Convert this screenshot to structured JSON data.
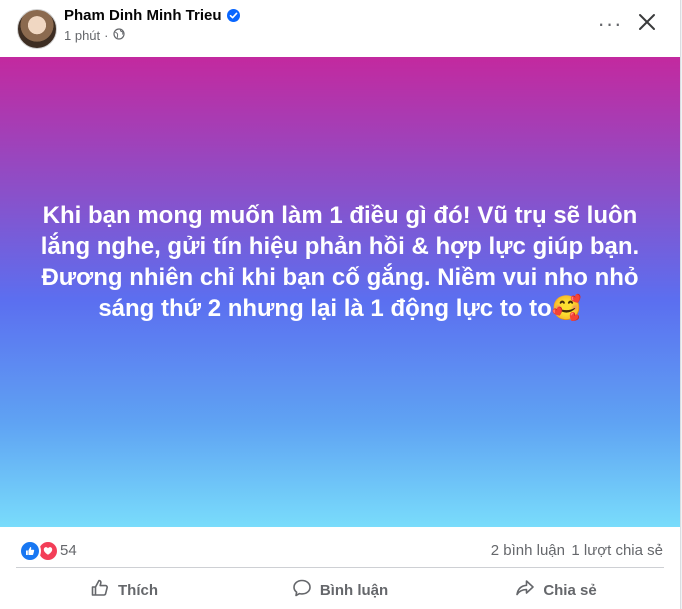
{
  "post": {
    "author": "Pham Dinh Minh Trieu",
    "time": "1 phút",
    "audience_icon": "globe-icon",
    "text": "Khi bạn mong muốn làm 1 điều gì đó! Vũ trụ sẽ luôn lắng nghe, gửi tín hiệu phản hồi & hợp lực giúp bạn. Đương nhiên chỉ khi bạn cố gắng. Niềm vui nho nhỏ sáng thứ 2 nhưng lại là 1 động lực to to🥰",
    "background_gradient": [
      "#c3299f",
      "#5b6ff0",
      "#79dcfb"
    ]
  },
  "header": {
    "more_label": "···",
    "close_icon": "close-icon"
  },
  "stats": {
    "reaction_count": "54",
    "comments": "2 bình luận",
    "shares": "1 lượt chia sẻ",
    "reaction_types": [
      "like",
      "love"
    ]
  },
  "actions": {
    "like": "Thích",
    "comment": "Bình luận",
    "share": "Chia sẻ"
  },
  "colors": {
    "verified": "#0866ff",
    "like": "#1877f2",
    "love": "#f33e58",
    "secondary_text": "#65676b"
  }
}
